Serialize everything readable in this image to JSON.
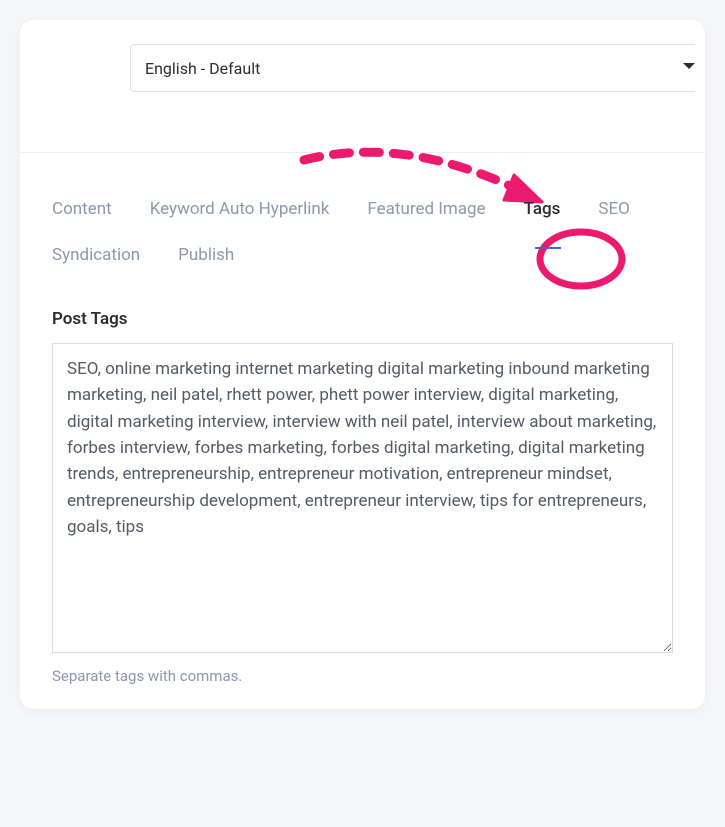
{
  "language_select": {
    "value": "English - Default"
  },
  "tabs": {
    "content": "Content",
    "keyword": "Keyword Auto Hyperlink",
    "featured": "Featured Image",
    "tags": "Tags",
    "seo": "SEO",
    "syndication": "Syndication",
    "publish": "Publish"
  },
  "post_tags": {
    "label": "Post Tags",
    "value": "SEO, online marketing internet marketing digital marketing inbound marketing marketing, neil patel, rhett power, phett power interview, digital marketing, digital marketing interview, interview with neil patel, interview about marketing, forbes interview, forbes marketing, forbes digital marketing, digital marketing trends, entrepreneurship, entrepreneur motivation, entrepreneur mindset, entrepreneurship development, entrepreneur interview, tips for entrepreneurs, goals, tips",
    "helper": "Separate tags with commas."
  },
  "annotation": {
    "color": "#ec1a6f"
  }
}
